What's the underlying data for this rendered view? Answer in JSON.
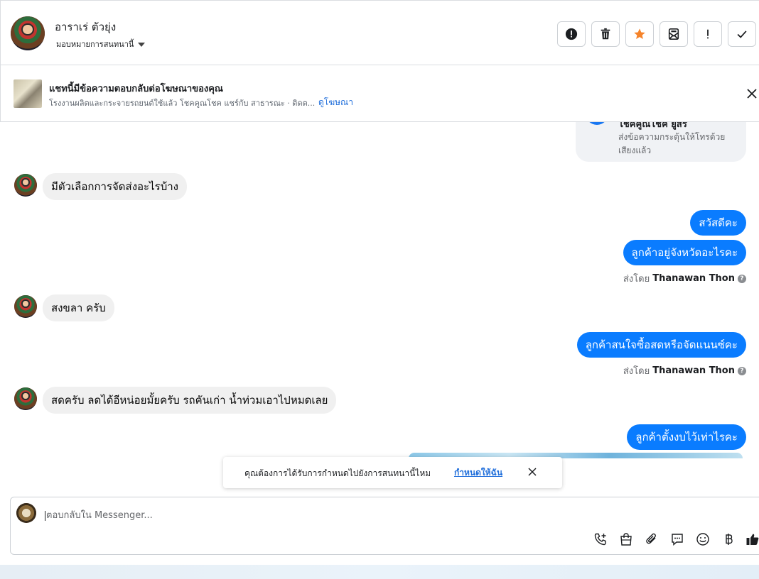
{
  "header": {
    "contact_name": "อาราเร่ ตัวยุ่ง",
    "assign_label": "มอบหมายการสนทนานี้",
    "actions": [
      {
        "name": "report-icon",
        "label": "report"
      },
      {
        "name": "trash-icon",
        "label": "delete"
      },
      {
        "name": "star-icon",
        "label": "star"
      },
      {
        "name": "mark-unread-icon",
        "label": "mark-unread"
      },
      {
        "name": "exclamation-icon",
        "label": "important"
      },
      {
        "name": "check-icon",
        "label": "done"
      }
    ],
    "star_color": "#f5832a"
  },
  "ad_banner": {
    "title": "แชทนี้มีข้อความตอบกลับต่อโฆษณาของคุณ",
    "subtitle": "โรงงานผลิตและกระจายรถยนต์ใช้แล้ว โชคคูณโชค แชร์กับ สาธารณะ · ติดต...",
    "link": "ดูโฆษณา"
  },
  "card": {
    "title": "โชคคูณโชค ยูสร",
    "text": "ส่งข้อความกระตุ้นให้โทรด้วยเสียงแล้ว"
  },
  "messages": {
    "in_1": "มีตัวเลือกการจัดส่งอะไรบ้าง",
    "out_1": "สวัสดีคะ",
    "out_2": "ลูกค้าอยู่จังหวัดอะไรคะ",
    "sent_by_1_prefix": "ส่งโดย",
    "sent_by_1_name": "Thanawan Thon",
    "in_2": "สงขลา ครับ",
    "out_3": "ลูกค้าสนใจซื้อสดหรือจัดแนนซ์คะ",
    "sent_by_2_prefix": "ส่งโดย",
    "sent_by_2_name": "Thanawan Thon",
    "in_3": "สดครับ ลดได้อีหน่อยมั้ยครับ รถคันเก่า น้ำท่วมเอาไปหมดเลย",
    "out_4": "ลูกค้าตั้งงบไว้เท่าไรคะ"
  },
  "toast": {
    "text": "คุณต้องการได้รับการกำหนดไปยังการสนทนานี้ไหม",
    "link": "กำหนดให้ฉัน"
  },
  "composer": {
    "placeholder": "ตอบกลับใน Messenger...",
    "tools": [
      "call-add-icon",
      "shopping-bag-icon",
      "attachment-icon",
      "saved-reply-icon",
      "emoji-icon",
      "baht-icon",
      "like-icon"
    ]
  },
  "colors": {
    "accent": "#0a7cff",
    "link": "#216fdb"
  }
}
